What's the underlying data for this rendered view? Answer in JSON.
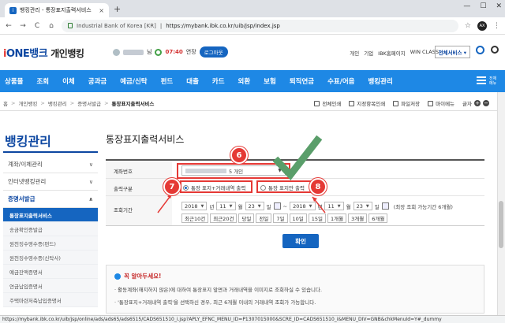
{
  "browser": {
    "tab_title": "뱅킹관리 - 통장표지출력서비스",
    "tab_close": "×",
    "new_tab": "+",
    "win_min": "—",
    "win_max": "☐",
    "win_close": "✕",
    "back": "←",
    "forward": "→",
    "reload": "C",
    "home": "⌂",
    "site_identity": "Industrial Bank of Korea [KR]",
    "url": "https://mybank.ibk.co.kr/uib/jsp/index.jsp",
    "star": "☆",
    "menu": "⋮",
    "avatar_text": "AX"
  },
  "site": {
    "logo_i": "i",
    "logo_brand": "ONE뱅크",
    "logo_sub": "개인뱅킹",
    "user_suffix": "님",
    "timer": "07:40",
    "extend_label": "연장",
    "logout_label": "로그아웃",
    "top_links": [
      "개인",
      "기업",
      "IBK홈페이지",
      "WIN CLASS"
    ],
    "all_services_label": "전체서비스 ▾",
    "nav_items": [
      "상품몰",
      "조회",
      "이체",
      "공과금",
      "예금/신탁",
      "펀드",
      "대출",
      "카드",
      "외환",
      "보험",
      "퇴직연금",
      "수표/어음",
      "뱅킹관리"
    ],
    "nav_more": "전체메뉴"
  },
  "breadcrumb": {
    "items": [
      "홈",
      "개인뱅킹",
      "뱅킹관리",
      "증명서발급",
      "통장표지출력서비스"
    ],
    "sep": ">",
    "tools": [
      "전체인쇄",
      "지정항목인쇄",
      "파일저장",
      "마이메뉴"
    ],
    "font_label": "글자",
    "font_plus": "+",
    "font_minus": "−"
  },
  "sidebar": {
    "title": "뱅킹관리",
    "items": [
      {
        "label": "계좌/이체관리",
        "chev": "∨"
      },
      {
        "label": "인터넷뱅킹관리",
        "chev": "∨"
      },
      {
        "label": "증명서발급",
        "chev": "∧"
      }
    ],
    "sub_items": [
      "통장표지출력서비스",
      "송금확인증발급",
      "원천징수영수증(펀드)",
      "원천징수영수증(신탁사)",
      "예금잔액증명서",
      "연금납입증명서",
      "주택마련저축납입증명서"
    ]
  },
  "content": {
    "title": "통장표지출력서비스",
    "account_label": "계좌번호",
    "account_value": "5 개인",
    "output_label": "출력구분",
    "radio_opt1": "통장 표지+거래내역 출력",
    "radio_opt2": "통장 표지만 출력",
    "period_label": "조회기간",
    "from_year": "2018",
    "from_month": "11",
    "from_day": "23",
    "to_year": "2018",
    "to_month": "11",
    "to_day": "23",
    "unit_year": "년",
    "unit_month": "월",
    "unit_day": "일",
    "tilde": "~",
    "period_note": "(최장 조회 가능기간 6개월)",
    "quick_buttons": [
      "최근10건",
      "최근20건",
      "당일",
      "전일",
      "7일",
      "10일",
      "15일",
      "1개월",
      "3개월",
      "6개월"
    ],
    "confirm_label": "확인",
    "notice_title": "꼭 알아두세요!",
    "notice_lines": [
      "· 활동계좌(해지하지 않은)에 대하여 통장표지 앞면과 거래내역을 이미지로 조회하실 수 있습니다.",
      "· '통장표지+거래내역 출력'을 선택하신 경우, 최근 6개월 이내의 거래내역 조회가 가능합니다."
    ]
  },
  "annotations": {
    "badge6": "6",
    "badge7": "7",
    "badge8": "8",
    "colors": {
      "red": "#e53935",
      "check": "#5a9e6a"
    }
  },
  "statusbar": {
    "text": "https://mybank.ibk.co.kr/uib/jsp/online/ads/ads65/ads6515/CADS651510_i.jsp?APLY_EFNC_MENU_ID=P1307015000&SCRE_ID=CADS651510_i&MENU_DIV=GNB&chkMenuId=Y#_dummy"
  }
}
